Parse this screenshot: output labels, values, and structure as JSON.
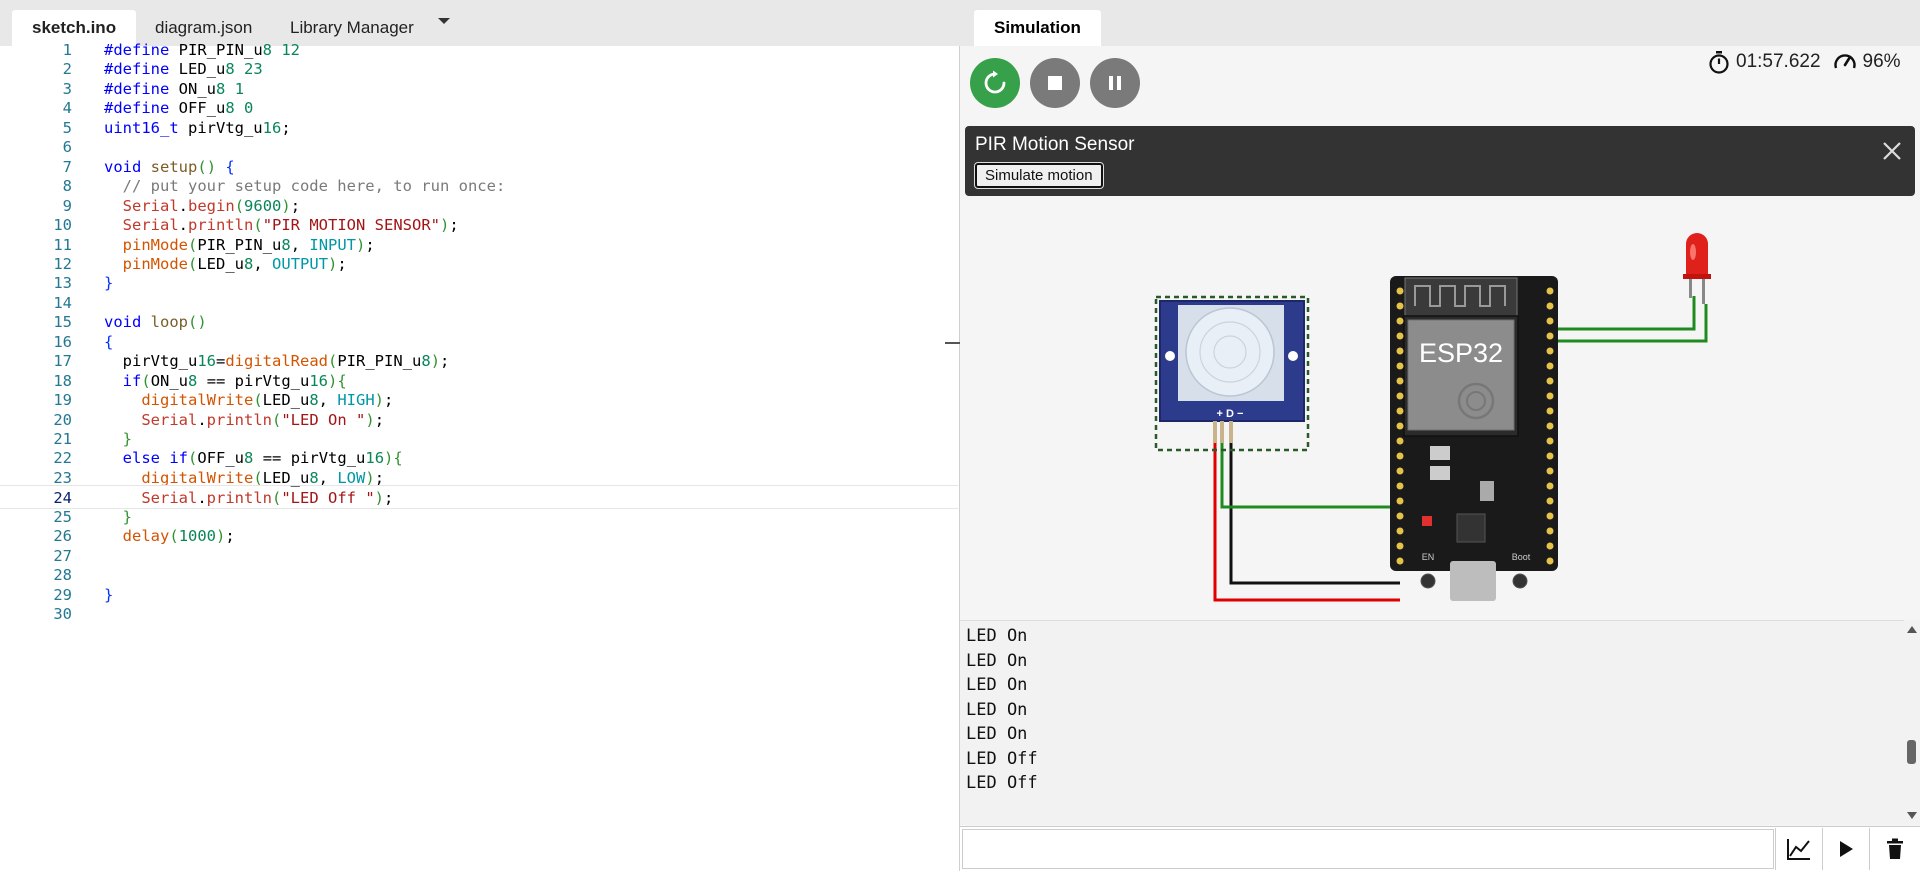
{
  "editor": {
    "tabs": [
      "sketch.ino",
      "diagram.json",
      "Library Manager"
    ],
    "active_tab": "sketch.ino",
    "current_line": 24,
    "lines": [
      "#define PIR_PIN_u8 12",
      "#define LED_u8 23",
      "#define ON_u8 1",
      "#define OFF_u8 0",
      "uint16_t pirVtg_u16;",
      "",
      "void setup() {",
      "  // put your setup code here, to run once:",
      "  Serial.begin(9600);",
      "  Serial.println(\"PIR MOTION SENSOR\");",
      "  pinMode(PIR_PIN_u8, INPUT);",
      "  pinMode(LED_u8, OUTPUT);",
      "}",
      "",
      "void loop()",
      "{",
      "  pirVtg_u16=digitalRead(PIR_PIN_u8);",
      "  if(ON_u8 == pirVtg_u16){",
      "    digitalWrite(LED_u8, HIGH);",
      "    Serial.println(\"LED On \");",
      "  }",
      "  else if(OFF_u8 == pirVtg_u16){",
      "    digitalWrite(LED_u8, LOW);",
      "    Serial.println(\"LED Off \");",
      "  }",
      "  delay(1000);",
      "",
      "",
      "}",
      ""
    ]
  },
  "simulation": {
    "tab_label": "Simulation",
    "elapsed_time": "01:57.622",
    "speed": "96%",
    "panel": {
      "title": "PIR Motion Sensor",
      "simulate_button": "Simulate motion"
    },
    "board_label": "ESP32",
    "pir_pin_labels": "+ D −",
    "en_label": "EN",
    "boot_label": "Boot"
  },
  "serial_monitor": {
    "lines": [
      "LED On",
      "LED On",
      "LED On",
      "LED On",
      "LED On",
      "LED Off",
      "LED Off"
    ],
    "input_placeholder": ""
  },
  "colors": {
    "restart": "#37a04a",
    "control_gray": "#7a7a7a",
    "board": "#1a1a1a",
    "pir_blue": "#2c3b8c",
    "led_red": "#e0201a",
    "wire_green": "#1f8a1f",
    "wire_red": "#e00000",
    "wire_black": "#111111"
  },
  "icons": [
    "restart-icon",
    "stop-icon",
    "pause-icon",
    "stopwatch-icon",
    "speedometer-icon",
    "close-icon",
    "plotter-icon",
    "play-icon",
    "trash-icon",
    "chevron-down-icon"
  ]
}
